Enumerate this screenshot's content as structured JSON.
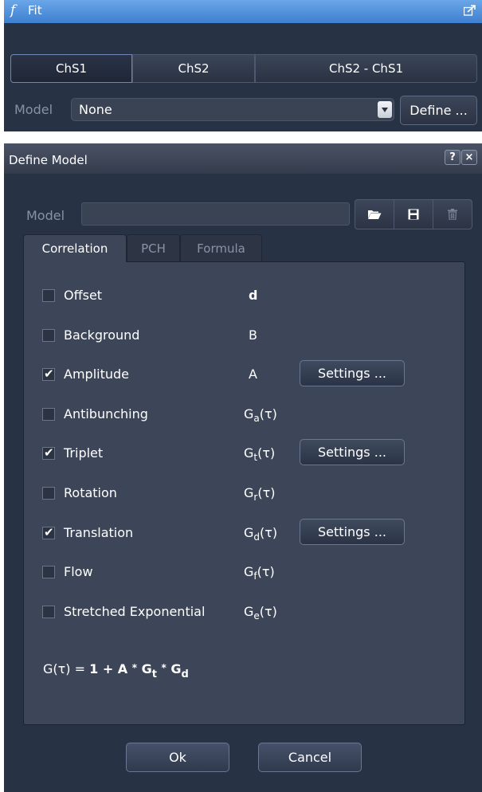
{
  "fit_panel": {
    "title": "Fit",
    "title_icon": "function-f-icon",
    "channel_tabs": [
      "ChS1",
      "ChS2",
      "ChS2 - ChS1"
    ],
    "selected_channel": "ChS1",
    "model_label": "Model",
    "model_value": "None",
    "define_button": "Define ..."
  },
  "define_model": {
    "title": "Define Model",
    "help_button": "?",
    "close_button": "×",
    "model_label": "Model",
    "model_value": "",
    "toolbar_icons": [
      "folder-open-icon",
      "save-icon",
      "trash-icon"
    ],
    "tabs": [
      "Correlation",
      "PCH",
      "Formula"
    ],
    "active_tab": "Correlation",
    "components": [
      {
        "label": "Offset",
        "checked": false,
        "symbol": "d",
        "sub": "",
        "settings": ""
      },
      {
        "label": "Background",
        "checked": false,
        "symbol": "B",
        "sub": "",
        "settings": ""
      },
      {
        "label": "Amplitude",
        "checked": true,
        "symbol": "A",
        "sub": "",
        "settings": "Settings ..."
      },
      {
        "label": "Antibunching",
        "checked": false,
        "symbol": "G",
        "sub": "a",
        "tail": "(τ)",
        "settings": ""
      },
      {
        "label": "Triplet",
        "checked": true,
        "symbol": "G",
        "sub": "t",
        "tail": "(τ)",
        "settings": "Settings ..."
      },
      {
        "label": "Rotation",
        "checked": false,
        "symbol": "G",
        "sub": "r",
        "tail": "(τ)",
        "settings": ""
      },
      {
        "label": "Translation",
        "checked": true,
        "symbol": "G",
        "sub": "d",
        "tail": "(τ)",
        "settings": "Settings ..."
      },
      {
        "label": "Flow",
        "checked": false,
        "symbol": "G",
        "sub": "f",
        "tail": "(τ)",
        "settings": ""
      },
      {
        "label": "Stretched Exponential",
        "checked": false,
        "symbol": "G",
        "sub": "e",
        "tail": "(τ)",
        "settings": ""
      }
    ],
    "formula": {
      "lhs": "G(τ) =",
      "rhs_start": "1 + A",
      "op": "*",
      "g": "G",
      "sub1": "t",
      "sub2": "d"
    },
    "ok_button": "Ok",
    "cancel_button": "Cancel"
  }
}
